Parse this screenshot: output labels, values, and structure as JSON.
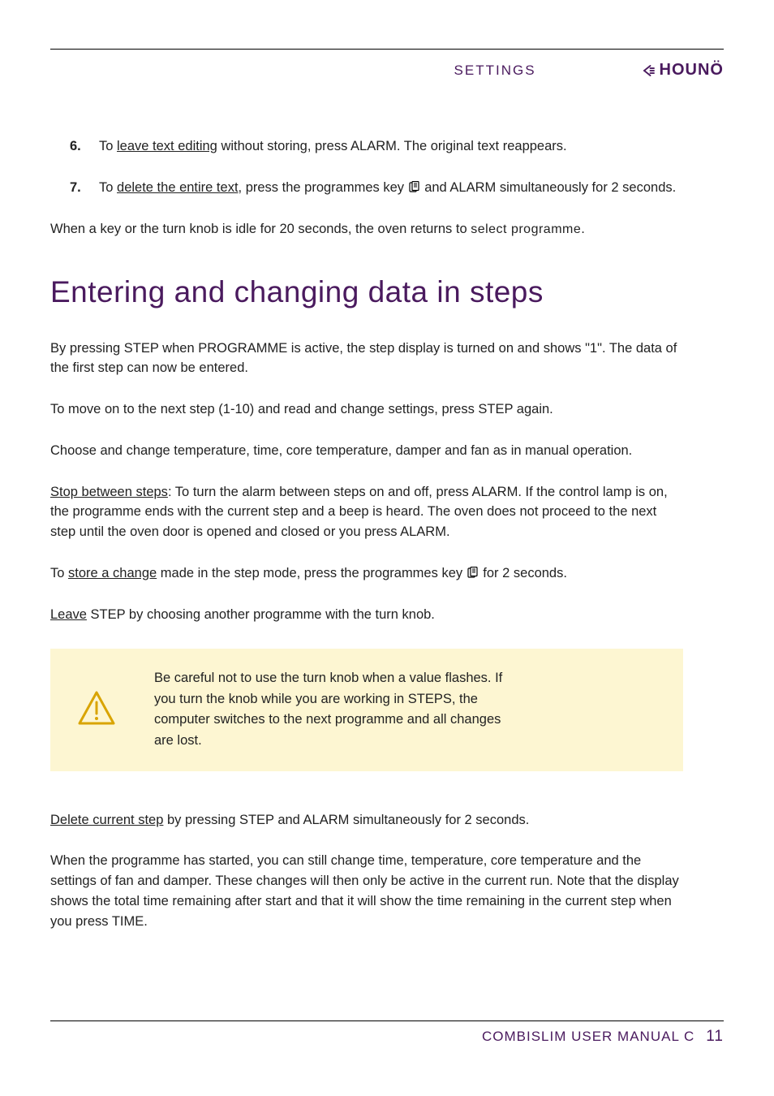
{
  "header": {
    "section": "SETTINGS",
    "brand": "HOUNÖ"
  },
  "list": {
    "item6": {
      "num": "6.",
      "pre": "To ",
      "u": "leave text editing",
      "post": " without storing, press ALARM. The original text reappears."
    },
    "item7": {
      "num": "7.",
      "pre": "To ",
      "u": "delete the entire text",
      "mid": ", press the programmes key ",
      "post": " and ALARM simultaneously for 2 seconds."
    }
  },
  "idle": {
    "pre": "When a key or the turn knob is idle for 20 seconds, the oven returns to ",
    "ui": "select programme",
    "post": "."
  },
  "heading": "Entering and changing data in steps",
  "p1": "By pressing STEP when PROGRAMME is active, the step display is turned on and shows \"1\". The data of the first step can now be entered.",
  "p2": "To move on to the next step (1-10) and read and change settings, press STEP again.",
  "p3": "Choose and change temperature, time, core temperature, damper and fan as in manual operation.",
  "p4": {
    "u": "Stop between steps",
    "rest": ": To turn the alarm between steps on and off, press ALARM. If the control lamp is on, the programme ends with the current step and a beep is heard. The oven does not proceed to the next step until the oven door is opened and closed or you press ALARM."
  },
  "p5": {
    "pre": "To ",
    "u": "store a change",
    "mid": " made in the step mode, press the programmes key ",
    "post": " for 2 seconds."
  },
  "p6": {
    "u": "Leave",
    "rest": " STEP by choosing another programme with the turn knob."
  },
  "callout": "Be careful not to use the turn knob when a value flashes. If you turn the knob while you are working in STEPS, the computer switches to the next programme and all changes are lost.",
  "p7": {
    "u": "Delete current step",
    "rest": " by pressing STEP and ALARM simultaneously for 2 seconds."
  },
  "p8": "When the programme has started, you can still change time, temperature, core temperature and the settings of fan and damper. These changes will then only be active in the current run. Note that the display shows the total time remaining after start and that it will show the time remaining in the current step when you press TIME.",
  "footer": {
    "title": "COMBISLIM USER MANUAL C",
    "page": "11"
  }
}
